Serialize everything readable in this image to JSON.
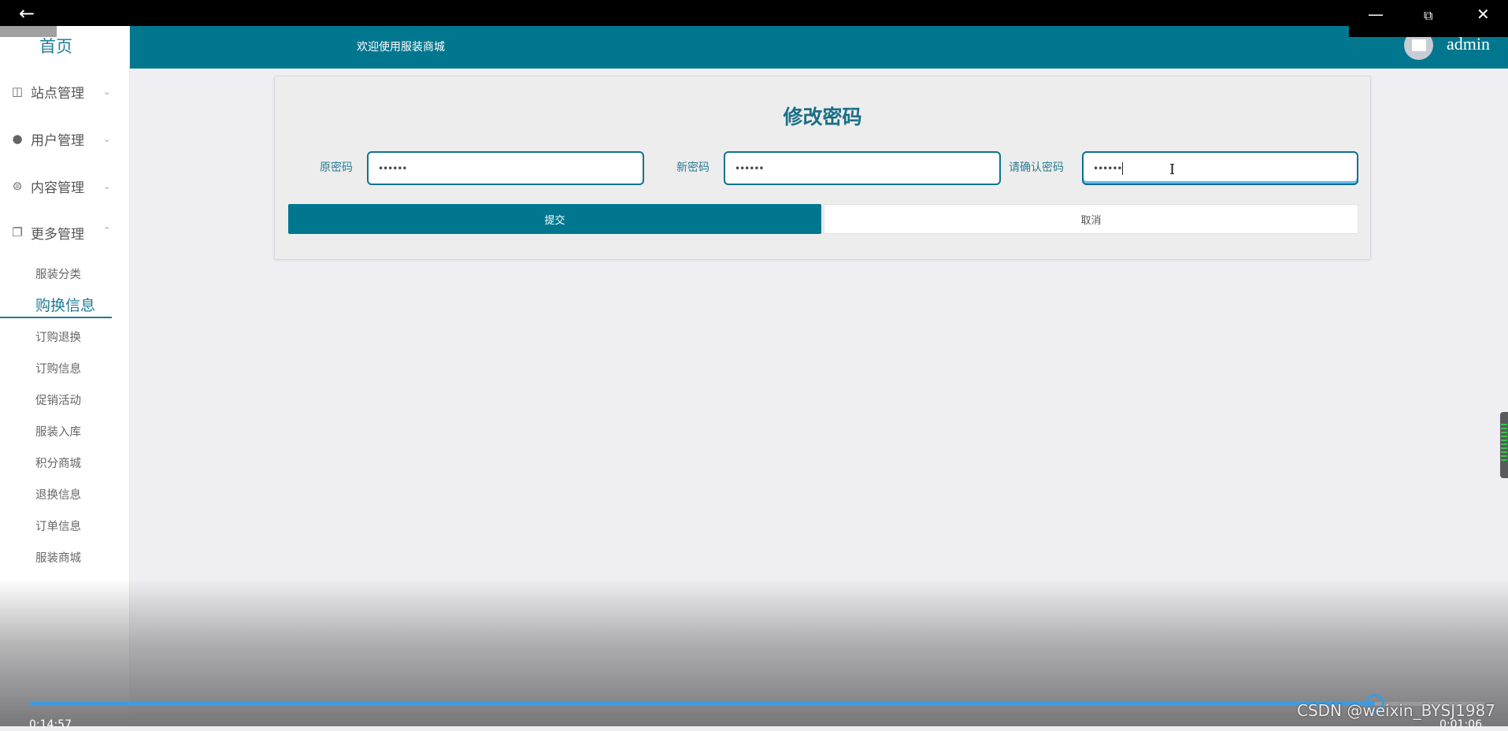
{
  "window": {
    "back_icon": "arrow-left-icon",
    "minimize_icon": "minimize-icon",
    "restore_icon": "restore-icon",
    "close_icon": "close-icon"
  },
  "sidebar": {
    "home": "首页",
    "menus": [
      {
        "label": "站点管理",
        "icon": "easel-icon",
        "expanded": false
      },
      {
        "label": "用户管理",
        "icon": "user-icon",
        "expanded": false
      },
      {
        "label": "内容管理",
        "icon": "chat-icon",
        "expanded": false
      },
      {
        "label": "更多管理",
        "icon": "copy-icon",
        "expanded": true
      }
    ],
    "subitems": [
      "服装分类",
      "购换信息",
      "订购退换",
      "订购信息",
      "促销活动",
      "服装入库",
      "积分商城",
      "退换信息",
      "订单信息",
      "服装商城"
    ],
    "active_subitem": "购换信息"
  },
  "header": {
    "title": "欢迎使用服装商城",
    "username": "admin",
    "accent": "#00778f"
  },
  "form": {
    "title": "修改密码",
    "fields": [
      {
        "label": "原密码",
        "value": "••••••"
      },
      {
        "label": "新密码",
        "value": "••••••"
      },
      {
        "label": "请确认密码",
        "value": "••••••"
      }
    ],
    "submit": "提交",
    "cancel": "取消"
  },
  "player": {
    "elapsed": "0:14:57",
    "remaining": "0:01:06",
    "progress_percent": 92.5,
    "watermark": "CSDN @weixin_BYSJ1987",
    "accent": "#3d9be0"
  }
}
